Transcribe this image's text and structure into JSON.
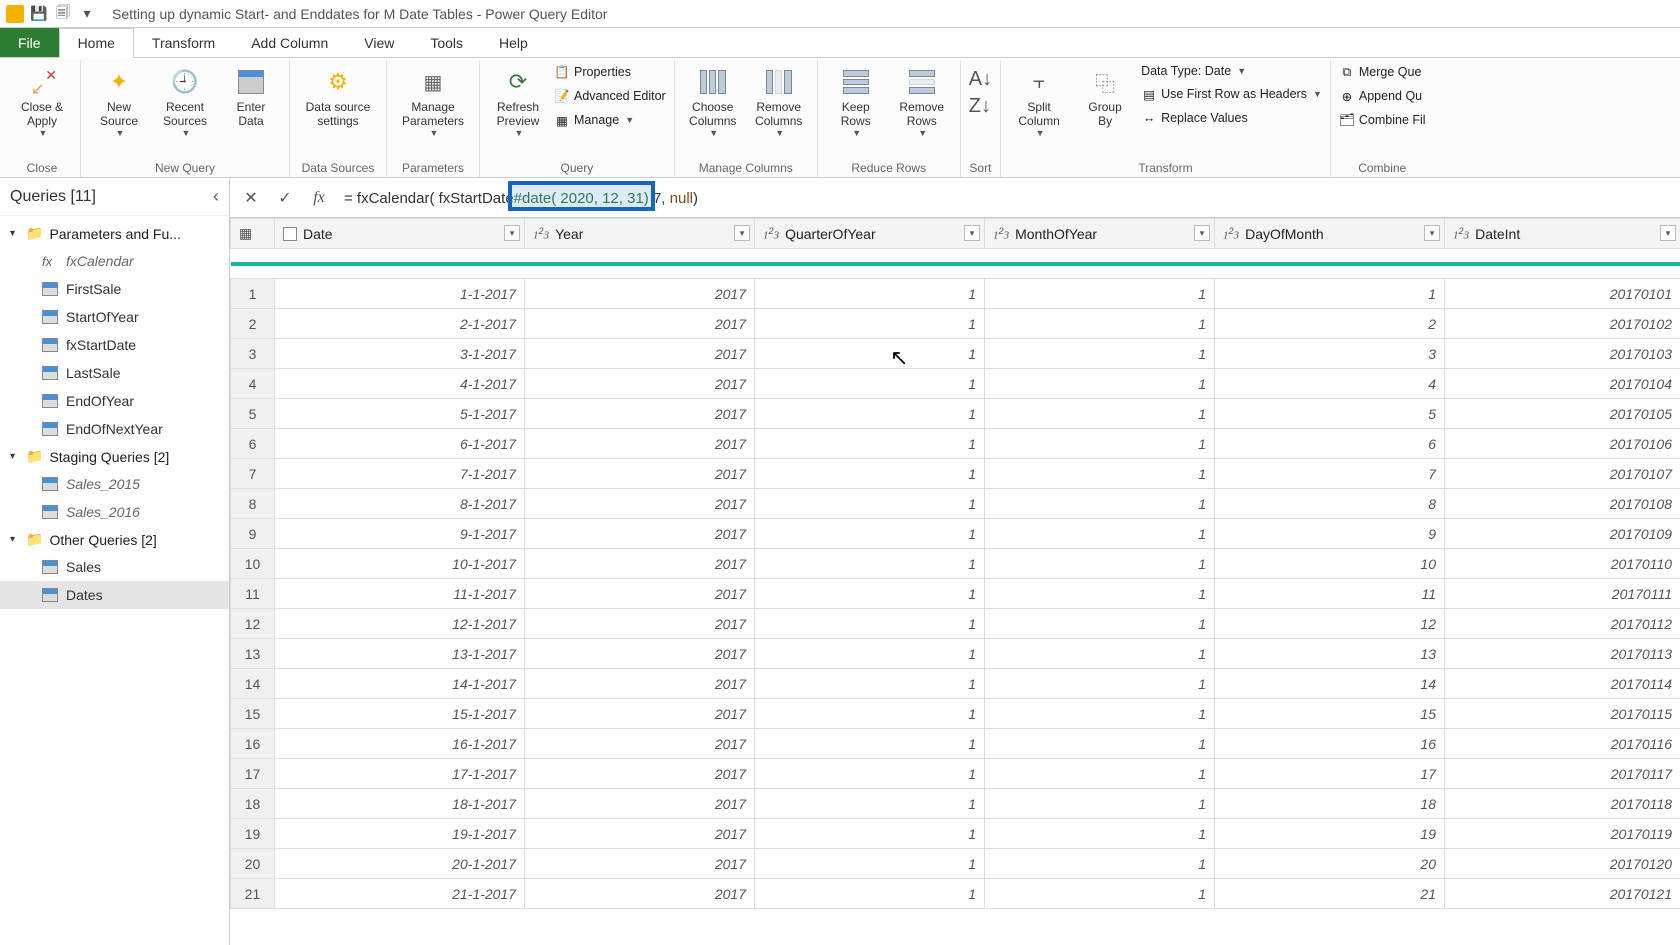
{
  "title": "Setting up dynamic Start- and Enddates for M Date Tables - Power Query Editor",
  "tabs": {
    "file": "File",
    "home": "Home",
    "transform": "Transform",
    "addcol": "Add Column",
    "view": "View",
    "tools": "Tools",
    "help": "Help"
  },
  "ribbon": {
    "close": {
      "closeApply": "Close &\nApply",
      "group": "Close"
    },
    "newQuery": {
      "newSource": "New\nSource",
      "recentSources": "Recent\nSources",
      "enterData": "Enter\nData",
      "group": "New Query"
    },
    "dataSources": {
      "settings": "Data source\nsettings",
      "group": "Data Sources"
    },
    "parameters": {
      "manage": "Manage\nParameters",
      "group": "Parameters"
    },
    "query": {
      "refresh": "Refresh\nPreview",
      "properties": "Properties",
      "advanced": "Advanced Editor",
      "manage": "Manage",
      "group": "Query"
    },
    "manageColumns": {
      "choose": "Choose\nColumns",
      "remove": "Remove\nColumns",
      "group": "Manage Columns"
    },
    "reduceRows": {
      "keep": "Keep\nRows",
      "remove": "Remove\nRows",
      "group": "Reduce Rows"
    },
    "sort": {
      "group": "Sort"
    },
    "transform": {
      "split": "Split\nColumn",
      "groupBy": "Group\nBy",
      "dataType": "Data Type: Date",
      "firstRow": "Use First Row as Headers",
      "replace": "Replace Values",
      "group": "Transform"
    },
    "combine": {
      "merge": "Merge Que",
      "append": "Append Qu",
      "combineFiles": "Combine Fil",
      "group": "Combine"
    }
  },
  "queriesPane": {
    "title": "Queries [11]",
    "groups": [
      {
        "label": "Parameters and Fu...",
        "items": [
          {
            "type": "fx",
            "label": "fxCalendar",
            "italic": true
          },
          {
            "type": "tbl",
            "label": "FirstSale"
          },
          {
            "type": "tbl",
            "label": "StartOfYear"
          },
          {
            "type": "tbl",
            "label": "fxStartDate"
          },
          {
            "type": "tbl",
            "label": "LastSale"
          },
          {
            "type": "tbl",
            "label": "EndOfYear"
          },
          {
            "type": "tbl",
            "label": "EndOfNextYear"
          }
        ]
      },
      {
        "label": "Staging Queries [2]",
        "items": [
          {
            "type": "tbl",
            "label": "Sales_2015",
            "italic": true
          },
          {
            "type": "tbl",
            "label": "Sales_2016",
            "italic": true
          }
        ]
      },
      {
        "label": "Other Queries [2]",
        "items": [
          {
            "type": "tbl",
            "label": "Sales"
          },
          {
            "type": "tbl",
            "label": "Dates",
            "selected": true
          }
        ]
      }
    ]
  },
  "formulaBar": {
    "prefix": "= fxCalendar( fxStartDate",
    "highlighted_fn": "#date(",
    "highlighted_args": " 2020, 12, 31",
    "highlighted_close": ")",
    "suffix_before_null": " 7, ",
    "null": "null",
    "suffix_end": ")"
  },
  "columns": [
    {
      "name": "Date",
      "type": "date"
    },
    {
      "name": "Year",
      "type": "num"
    },
    {
      "name": "QuarterOfYear",
      "type": "num"
    },
    {
      "name": "MonthOfYear",
      "type": "num"
    },
    {
      "name": "DayOfMonth",
      "type": "num"
    },
    {
      "name": "DateInt",
      "type": "num"
    }
  ],
  "rows": [
    {
      "n": 1,
      "date": "1-1-2017",
      "year": 2017,
      "q": 1,
      "m": 1,
      "d": 1,
      "di": 20170101
    },
    {
      "n": 2,
      "date": "2-1-2017",
      "year": 2017,
      "q": 1,
      "m": 1,
      "d": 2,
      "di": 20170102
    },
    {
      "n": 3,
      "date": "3-1-2017",
      "year": 2017,
      "q": 1,
      "m": 1,
      "d": 3,
      "di": 20170103
    },
    {
      "n": 4,
      "date": "4-1-2017",
      "year": 2017,
      "q": 1,
      "m": 1,
      "d": 4,
      "di": 20170104
    },
    {
      "n": 5,
      "date": "5-1-2017",
      "year": 2017,
      "q": 1,
      "m": 1,
      "d": 5,
      "di": 20170105
    },
    {
      "n": 6,
      "date": "6-1-2017",
      "year": 2017,
      "q": 1,
      "m": 1,
      "d": 6,
      "di": 20170106
    },
    {
      "n": 7,
      "date": "7-1-2017",
      "year": 2017,
      "q": 1,
      "m": 1,
      "d": 7,
      "di": 20170107
    },
    {
      "n": 8,
      "date": "8-1-2017",
      "year": 2017,
      "q": 1,
      "m": 1,
      "d": 8,
      "di": 20170108
    },
    {
      "n": 9,
      "date": "9-1-2017",
      "year": 2017,
      "q": 1,
      "m": 1,
      "d": 9,
      "di": 20170109
    },
    {
      "n": 10,
      "date": "10-1-2017",
      "year": 2017,
      "q": 1,
      "m": 1,
      "d": 10,
      "di": 20170110
    },
    {
      "n": 11,
      "date": "11-1-2017",
      "year": 2017,
      "q": 1,
      "m": 1,
      "d": 11,
      "di": 20170111
    },
    {
      "n": 12,
      "date": "12-1-2017",
      "year": 2017,
      "q": 1,
      "m": 1,
      "d": 12,
      "di": 20170112
    },
    {
      "n": 13,
      "date": "13-1-2017",
      "year": 2017,
      "q": 1,
      "m": 1,
      "d": 13,
      "di": 20170113
    },
    {
      "n": 14,
      "date": "14-1-2017",
      "year": 2017,
      "q": 1,
      "m": 1,
      "d": 14,
      "di": 20170114
    },
    {
      "n": 15,
      "date": "15-1-2017",
      "year": 2017,
      "q": 1,
      "m": 1,
      "d": 15,
      "di": 20170115
    },
    {
      "n": 16,
      "date": "16-1-2017",
      "year": 2017,
      "q": 1,
      "m": 1,
      "d": 16,
      "di": 20170116
    },
    {
      "n": 17,
      "date": "17-1-2017",
      "year": 2017,
      "q": 1,
      "m": 1,
      "d": 17,
      "di": 20170117
    },
    {
      "n": 18,
      "date": "18-1-2017",
      "year": 2017,
      "q": 1,
      "m": 1,
      "d": 18,
      "di": 20170118
    },
    {
      "n": 19,
      "date": "19-1-2017",
      "year": 2017,
      "q": 1,
      "m": 1,
      "d": 19,
      "di": 20170119
    },
    {
      "n": 20,
      "date": "20-1-2017",
      "year": 2017,
      "q": 1,
      "m": 1,
      "d": 20,
      "di": 20170120
    },
    {
      "n": 21,
      "date": "21-1-2017",
      "year": 2017,
      "q": 1,
      "m": 1,
      "d": 21,
      "di": 20170121
    }
  ]
}
